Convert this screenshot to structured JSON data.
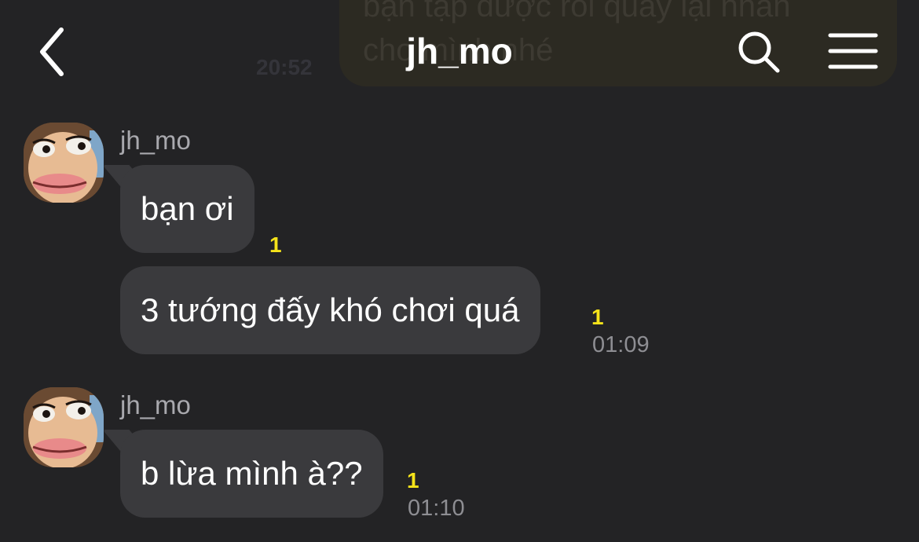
{
  "header": {
    "title": "jh_mo",
    "back_icon": "chevron-left-icon",
    "search_icon": "search-icon",
    "menu_icon": "hamburger-menu-icon"
  },
  "previous_message": {
    "text": "bạn tập được rồi quay lại nhắn\ncho mình nhé",
    "time": "20:52"
  },
  "groups": [
    {
      "sender": "jh_mo",
      "messages": [
        {
          "text": "bạn ơi",
          "unread": "1",
          "time": ""
        },
        {
          "text": "3 tướng đấy khó chơi quá",
          "unread": "1",
          "time": "01:09"
        }
      ]
    },
    {
      "sender": "jh_mo",
      "messages": [
        {
          "text": "b lừa mình à??",
          "unread": "1",
          "time": "01:10"
        }
      ]
    }
  ],
  "colors": {
    "background": "#232325",
    "bubble": "#3a3a3d",
    "unread": "#f5e31a",
    "meta_text": "#8e8e93"
  }
}
